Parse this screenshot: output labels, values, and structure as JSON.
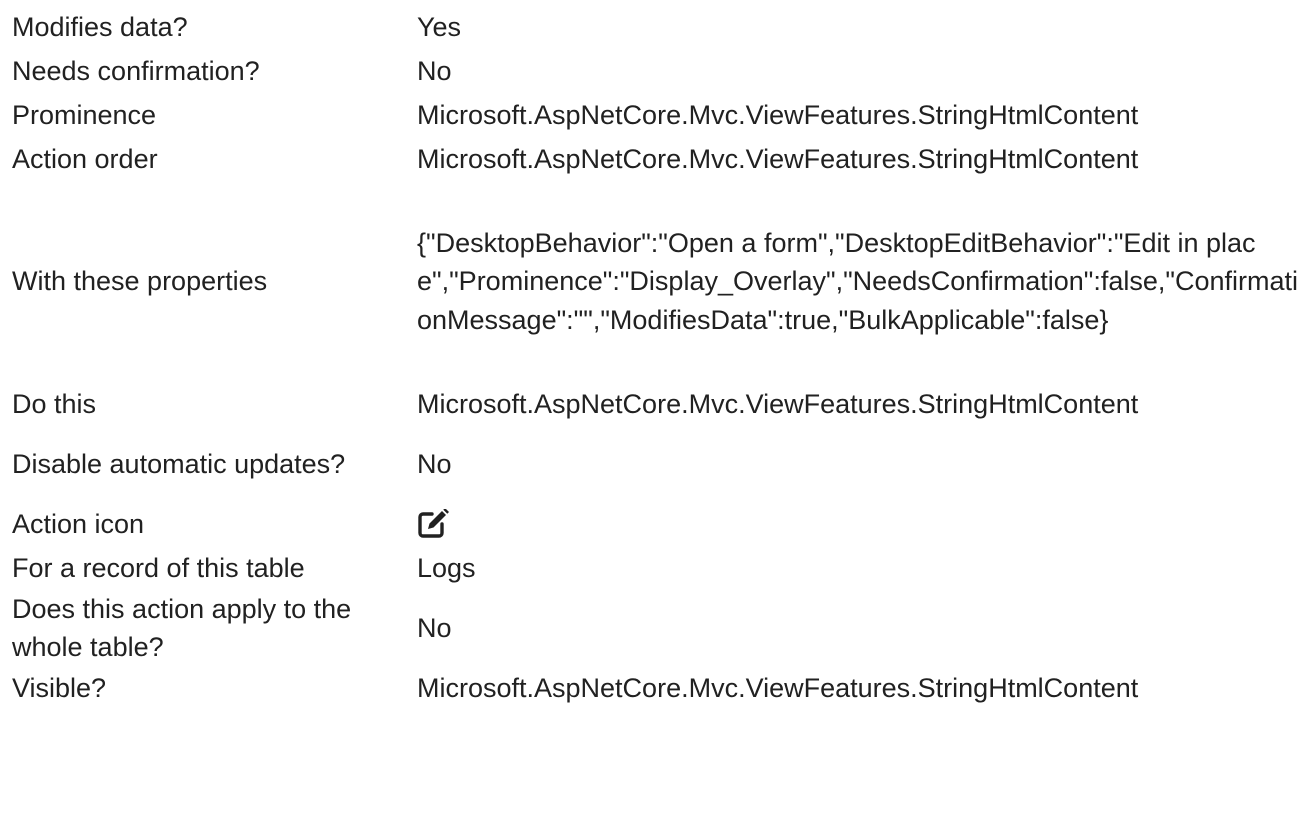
{
  "properties": [
    {
      "label": "Modifies data?",
      "value": "Yes"
    },
    {
      "label": "Needs confirmation?",
      "value": "No"
    },
    {
      "label": "Prominence",
      "value": "Microsoft.AspNetCore.Mvc.ViewFeatures.StringHtmlContent"
    },
    {
      "label": "Action order",
      "value": "Microsoft.AspNetCore.Mvc.ViewFeatures.StringHtmlContent"
    },
    {
      "label": "With these properties",
      "value": "{\"DesktopBehavior\":\"Open a form\",\"DesktopEditBehavior\":\"Edit in place\",\"Prominence\":\"Display_Overlay\",\"NeedsConfirmation\":false,\"ConfirmationMessage\":\"\",\"ModifiesData\":true,\"BulkApplicable\":false}"
    },
    {
      "label": "Do this",
      "value": "Microsoft.AspNetCore.Mvc.ViewFeatures.StringHtmlContent"
    },
    {
      "label": "Disable automatic updates?",
      "value": "No"
    },
    {
      "label": "Action icon",
      "icon": "edit-icon"
    },
    {
      "label": "For a record of this table",
      "value": "Logs"
    },
    {
      "label": "Does this action apply to the whole table?",
      "value": "No"
    },
    {
      "label": "Visible?",
      "value": "Microsoft.AspNetCore.Mvc.ViewFeatures.StringHtmlContent"
    }
  ]
}
